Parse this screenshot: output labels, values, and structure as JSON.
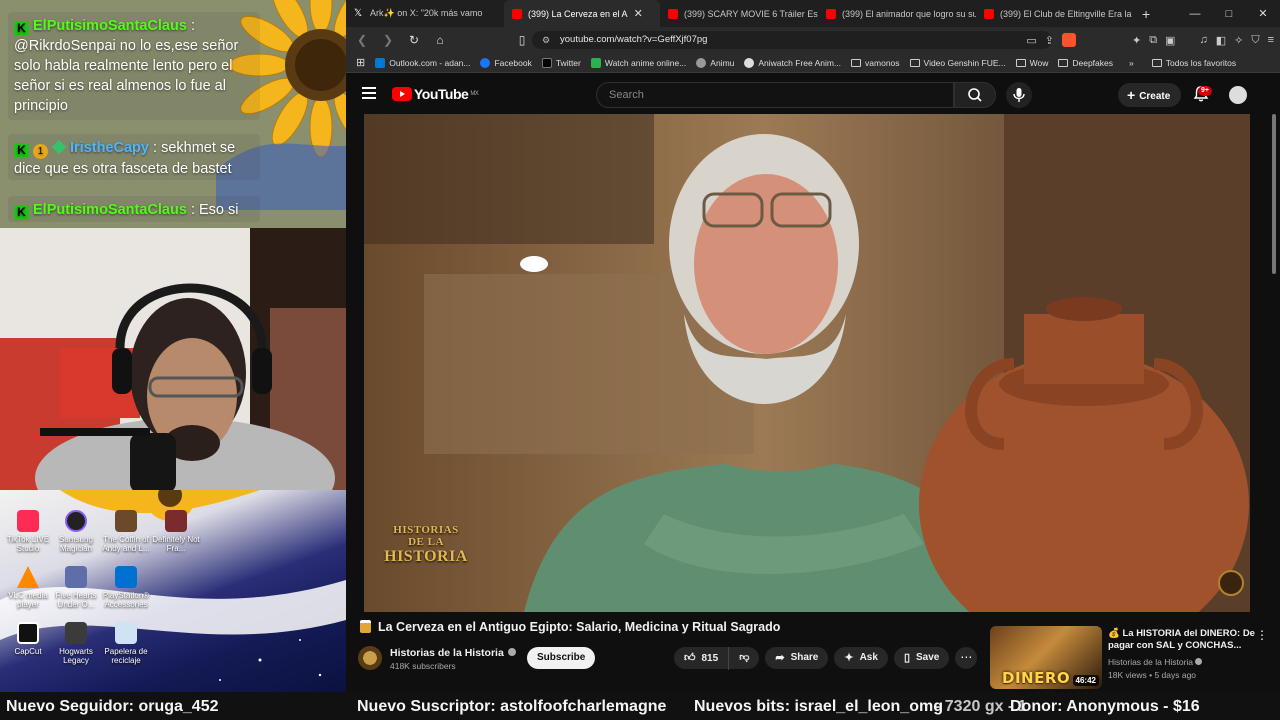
{
  "chat": {
    "messages": [
      {
        "platform": "K",
        "user": "ElPutisimoSantaClaus",
        "text": ": @RikrdoSenpai no lo es,ese señor solo habla realmente lento pero el señor si es real almenos lo fue al principio"
      },
      {
        "platform": "K",
        "badge": "1",
        "user": "IristheCapy",
        "text": ": sekhmet se dice que es otra fasceta de bastet"
      },
      {
        "platform": "K",
        "user": "ElPutisimoSantaClaus",
        "text": ": Eso si"
      }
    ]
  },
  "desktop": {
    "icons": [
      {
        "label": "TikTok LIVE Studio"
      },
      {
        "label": "Samsung Magician"
      },
      {
        "label": "The Coffin of Andy and L..."
      },
      {
        "label": "Definitely Not Fra..."
      },
      {
        "label": "VLC media player"
      },
      {
        "label": "Five Hearts Under O..."
      },
      {
        "label": "PlayStation® Accessories"
      },
      {
        "label": "CapCut"
      },
      {
        "label": "Hogwarts Legacy"
      },
      {
        "label": "Papelera de reciclaje"
      }
    ]
  },
  "browser": {
    "tabs": [
      {
        "label": "Ark✨ on X: \"20k más vamo",
        "fav": "#ffffff",
        "active": false
      },
      {
        "label": "(399) La Cerveza en el A",
        "fav": "#ff0000",
        "active": true
      },
      {
        "label": "(399) SCARY MOVIE 6 Tráiler Españ",
        "fav": "#ff0000",
        "active": false
      },
      {
        "label": "(399) El animador que logro su sue",
        "fav": "#ff0000",
        "active": false
      },
      {
        "label": "(399) El Club de Eltingville Era la M",
        "fav": "#ff0000",
        "active": false
      }
    ],
    "new_tab": "+",
    "window_controls": [
      "—",
      "□",
      "✕"
    ],
    "url": "youtube.com/watch?v=GeffXjf07pg",
    "bookmarks": [
      {
        "label": "Outlook.com - adan...",
        "color": "#0078d4",
        "folder": false
      },
      {
        "label": "Facebook",
        "color": "#1877f2",
        "folder": false
      },
      {
        "label": "Twitter",
        "color": "#000000",
        "folder": false
      },
      {
        "label": "Watch anime online...",
        "color": "#2bb24c",
        "folder": false
      },
      {
        "label": "Animu",
        "color": "#999999",
        "folder": false
      },
      {
        "label": "Aniwatch Free Anim...",
        "color": "#dddddd",
        "folder": false
      },
      {
        "label": "vamonos",
        "color": "",
        "folder": true
      },
      {
        "label": "Video Genshin FUE...",
        "color": "",
        "folder": true
      },
      {
        "label": "Wow",
        "color": "",
        "folder": true
      },
      {
        "label": "Deepfakes",
        "color": "",
        "folder": true
      }
    ],
    "all_bookmarks": "Todos los favoritos"
  },
  "youtube": {
    "logo_text": "YouTube",
    "region": "MX",
    "search_placeholder": "Search",
    "create_label": "Create",
    "notifications": "9+",
    "video": {
      "watermark_line1": "HISTORIAS DE LA",
      "watermark_line2": "HISTORIA",
      "title": "La Cerveza en el Antiguo Egipto: Salario, Medicina y Ritual Sagrado",
      "channel": "Historias de la Historia",
      "subscribers": "418K subscribers",
      "subscribe_label": "Subscribe",
      "likes": "815",
      "share_label": "Share",
      "ask_label": "Ask",
      "save_label": "Save"
    },
    "recommendation": {
      "title": "💰 La HISTORIA del DINERO: De pagar con SAL y CONCHAS...",
      "channel": "Historias de la Historia",
      "meta": "18K views • 5 days ago",
      "duration": "46:42",
      "thumb_text": "DINERO"
    }
  },
  "ticker": {
    "follower": "Nuevo Seguidor: oruga_452",
    "subscriber": "Nuevo Suscriptor: astolfoofcharlemagne",
    "bits": "Nuevos bits: israel_el_leon_omg",
    "overlap": "- 7320 gx - 1",
    "donor": "Donor: Anonymous - $16"
  }
}
